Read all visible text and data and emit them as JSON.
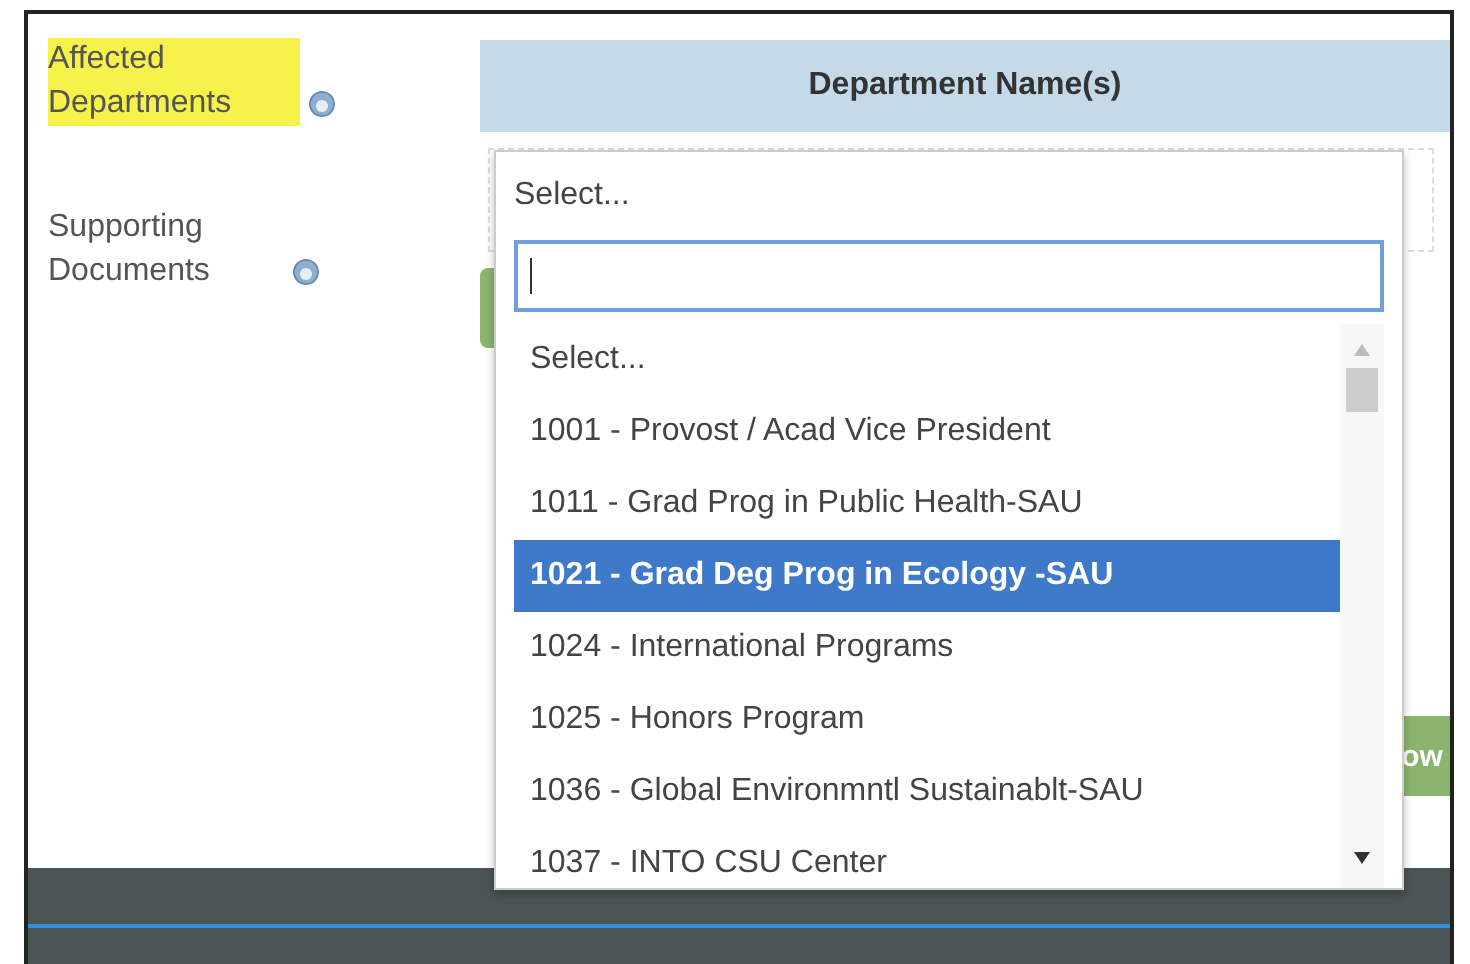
{
  "fields": [
    {
      "label": "Affected Departments",
      "highlighted": true
    },
    {
      "label": "Supporting Documents",
      "highlighted": false
    }
  ],
  "table": {
    "columns": [
      "Department Name(s)"
    ]
  },
  "select": {
    "value": "Select...",
    "search": {
      "focused": true
    },
    "options": [
      {
        "label": "Select...",
        "highlighted": false
      },
      {
        "label": "1001 - Provost / Acad Vice President",
        "highlighted": false
      },
      {
        "label": "1011 - Grad Prog in Public Health-SAU",
        "highlighted": false
      },
      {
        "label": "1021 - Grad Deg Prog in Ecology -SAU",
        "highlighted": true
      },
      {
        "label": "1024 - International Programs",
        "highlighted": false
      },
      {
        "label": "1025 - Honors Program",
        "highlighted": false
      },
      {
        "label": "1036 - Global Environmntl Sustainablt-SAU",
        "highlighted": false
      },
      {
        "label": "1037 - INTO CSU Center",
        "highlighted": false
      }
    ]
  },
  "side_button": {
    "label": "ow"
  }
}
